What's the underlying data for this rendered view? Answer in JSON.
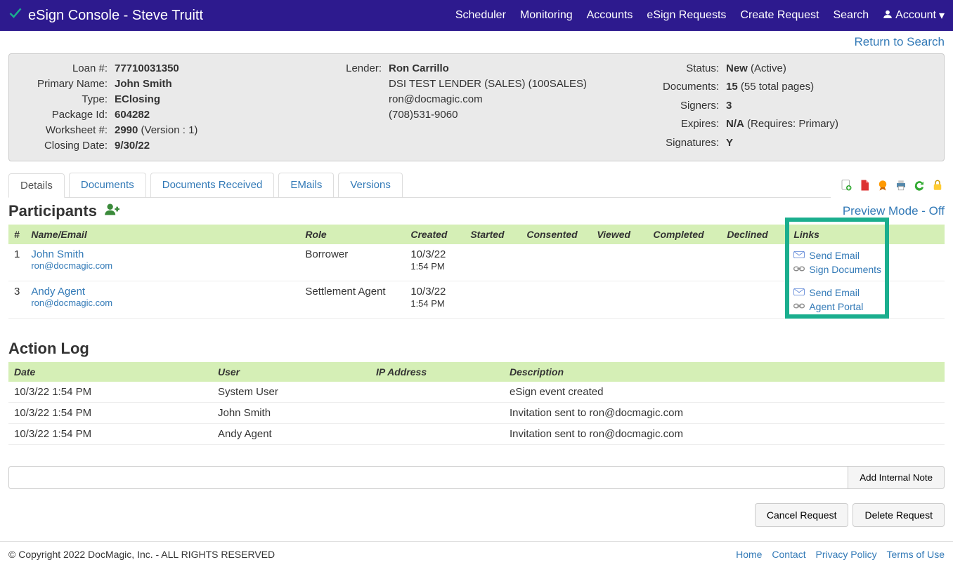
{
  "navbar": {
    "brand": "eSign Console - Steve Truitt",
    "links": [
      "Scheduler",
      "Monitoring",
      "Accounts",
      "eSign Requests",
      "Create Request",
      "Search"
    ],
    "account": "Account"
  },
  "return_link": "Return to Search",
  "info": {
    "loan_label": "Loan #:",
    "loan": "77710031350",
    "primary_name_label": "Primary Name:",
    "primary_name": "John Smith",
    "type_label": "Type:",
    "type": "EClosing",
    "package_label": "Package Id:",
    "package": "604282",
    "worksheet_label": "Worksheet #:",
    "worksheet_b": "2990",
    "worksheet_rest": " (Version : 1)",
    "closing_label": "Closing Date:",
    "closing": "9/30/22",
    "lender_label": "Lender:",
    "lender_name": "Ron Carrillo",
    "lender_company": "DSI TEST LENDER (SALES) (100SALES)",
    "lender_email": "ron@docmagic.com",
    "lender_phone": "(708)531-9060",
    "status_label": "Status:",
    "status_b": "New",
    "status_rest": " (Active)",
    "documents_label": "Documents:",
    "documents_b": "15",
    "documents_rest": " (55 total pages)",
    "signers_label": "Signers:",
    "signers": "3",
    "expires_label": "Expires:",
    "expires_b": "N/A",
    "expires_rest": " (Requires: Primary)",
    "signatures_label": "Signatures:",
    "signatures": "Y"
  },
  "tabs": [
    "Details",
    "Documents",
    "Documents Received",
    "EMails",
    "Versions"
  ],
  "participants_title": "Participants",
  "preview_mode": "Preview Mode - Off",
  "participants_headers": [
    "#",
    "Name/Email",
    "Role",
    "Created",
    "Started",
    "Consented",
    "Viewed",
    "Completed",
    "Declined",
    "Links"
  ],
  "participants": [
    {
      "num": "1",
      "name": "John Smith",
      "email": "ron@docmagic.com",
      "role": "Borrower",
      "created_date": "10/3/22",
      "created_time": "1:54 PM",
      "links": [
        {
          "icon": "mail",
          "label": "Send Email"
        },
        {
          "icon": "link",
          "label": "Sign Documents"
        }
      ]
    },
    {
      "num": "3",
      "name": "Andy Agent",
      "email": "ron@docmagic.com",
      "role": "Settlement Agent",
      "created_date": "10/3/22",
      "created_time": "1:54 PM",
      "links": [
        {
          "icon": "mail",
          "label": "Send Email"
        },
        {
          "icon": "link",
          "label": "Agent Portal"
        }
      ]
    }
  ],
  "action_log_title": "Action Log",
  "action_headers": [
    "Date",
    "User",
    "IP Address",
    "Description"
  ],
  "action_log": [
    {
      "date": "10/3/22 1:54 PM",
      "user": "System User",
      "ip": "",
      "desc": "eSign event created"
    },
    {
      "date": "10/3/22 1:54 PM",
      "user": "John Smith",
      "ip": "",
      "desc": "Invitation sent to ron@docmagic.com"
    },
    {
      "date": "10/3/22 1:54 PM",
      "user": "Andy Agent",
      "ip": "",
      "desc": "Invitation sent to ron@docmagic.com"
    }
  ],
  "note_button": "Add Internal Note",
  "cancel_request": "Cancel Request",
  "delete_request": "Delete Request",
  "footer_copyright": "© Copyright 2022 DocMagic, Inc. - ALL RIGHTS RESERVED",
  "footer_links": [
    "Home",
    "Contact",
    "Privacy Policy",
    "Terms of Use"
  ]
}
